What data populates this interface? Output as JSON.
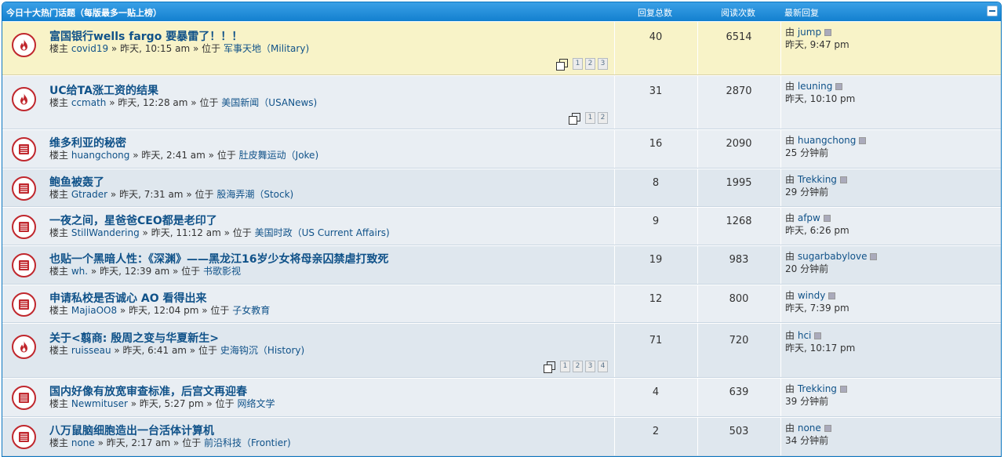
{
  "header": {
    "title": "今日十大热门话题（每版最多一贴上榜）",
    "col_replies": "回复总数",
    "col_views": "阅读次数",
    "col_last": "最新回复"
  },
  "topics": [
    {
      "title": "富国银行wells fargo 要暴雷了！！！",
      "by": "楼主",
      "author": "covid19",
      "time": "昨天, 10:15 am",
      "loc": "位于",
      "forum": "军事天地（Military)",
      "replies": "40",
      "views": "6514",
      "last_by": "由",
      "last_user": "jump",
      "last_time": "昨天, 9:47 pm",
      "hot": true,
      "pages": [
        "1",
        "2",
        "3"
      ]
    },
    {
      "title": "UC给TA涨工资的结果",
      "by": "楼主",
      "author": "ccmath",
      "time": "昨天, 12:28 am",
      "loc": "位于",
      "forum": "美国新闻（USANews)",
      "replies": "31",
      "views": "2870",
      "last_by": "由",
      "last_user": "leuning",
      "last_time": "昨天, 10:10 pm",
      "hot": true,
      "pages": [
        "1",
        "2"
      ]
    },
    {
      "title": "维多利亚的秘密",
      "by": "楼主",
      "author": "huangchong",
      "time": "昨天, 2:41 am",
      "loc": "位于",
      "forum": "肚皮舞运动（Joke)",
      "replies": "16",
      "views": "2090",
      "last_by": "由",
      "last_user": "huangchong",
      "last_time": "25 分钟前",
      "hot": false,
      "pages": []
    },
    {
      "title": "鲍鱼被轰了",
      "by": "楼主",
      "author": "Gtrader",
      "time": "昨天, 7:31 am",
      "loc": "位于",
      "forum": "股海弄潮（Stock)",
      "replies": "8",
      "views": "1995",
      "last_by": "由",
      "last_user": "Trekking",
      "last_time": "29 分钟前",
      "hot": false,
      "pages": []
    },
    {
      "title": "一夜之间，星爸爸CEO都是老印了",
      "by": "楼主",
      "author": "StillWandering",
      "time": "昨天, 11:12 am",
      "loc": "位于",
      "forum": "美国时政（US Current Affairs)",
      "replies": "9",
      "views": "1268",
      "last_by": "由",
      "last_user": "afpw",
      "last_time": "昨天, 6:26 pm",
      "hot": false,
      "pages": []
    },
    {
      "title": "也贴一个黑暗人性：《深渊》——黑龙江16岁少女将母亲囚禁虐打致死",
      "by": "楼主",
      "author": "wh.",
      "time": "昨天, 12:39 am",
      "loc": "位于",
      "forum": "书歌影视",
      "replies": "19",
      "views": "983",
      "last_by": "由",
      "last_user": "sugarbabylove",
      "last_time": "20 分钟前",
      "hot": false,
      "pages": []
    },
    {
      "title": "申请私校是否诚心 AO 看得出来",
      "by": "楼主",
      "author": "MajiaOO8",
      "time": "昨天, 12:04 pm",
      "loc": "位于",
      "forum": "子女教育",
      "replies": "12",
      "views": "800",
      "last_by": "由",
      "last_user": "windy",
      "last_time": "昨天, 7:39 pm",
      "hot": false,
      "pages": []
    },
    {
      "title": "关于<翦商: 殷周之变与华夏新生>",
      "by": "楼主",
      "author": "ruisseau",
      "time": "昨天, 6:41 am",
      "loc": "位于",
      "forum": "史海钩沉（History)",
      "replies": "71",
      "views": "720",
      "last_by": "由",
      "last_user": "hci",
      "last_time": "昨天, 10:17 pm",
      "hot": true,
      "pages": [
        "1",
        "2",
        "3",
        "4"
      ]
    },
    {
      "title": "国内好像有放宽审查标准，后宫文再迎春",
      "by": "楼主",
      "author": "Newmituser",
      "time": "昨天, 5:27 pm",
      "loc": "位于",
      "forum": "网络文学",
      "replies": "4",
      "views": "639",
      "last_by": "由",
      "last_user": "Trekking",
      "last_time": "39 分钟前",
      "hot": false,
      "pages": []
    },
    {
      "title": "八万鼠脑细胞造出一台活体计算机",
      "by": "楼主",
      "author": "none",
      "time": "昨天, 2:17 am",
      "loc": "位于",
      "forum": "前沿科技（Frontier)",
      "replies": "2",
      "views": "503",
      "last_by": "由",
      "last_user": "none",
      "last_time": "34 分钟前",
      "hot": false,
      "pages": []
    }
  ]
}
